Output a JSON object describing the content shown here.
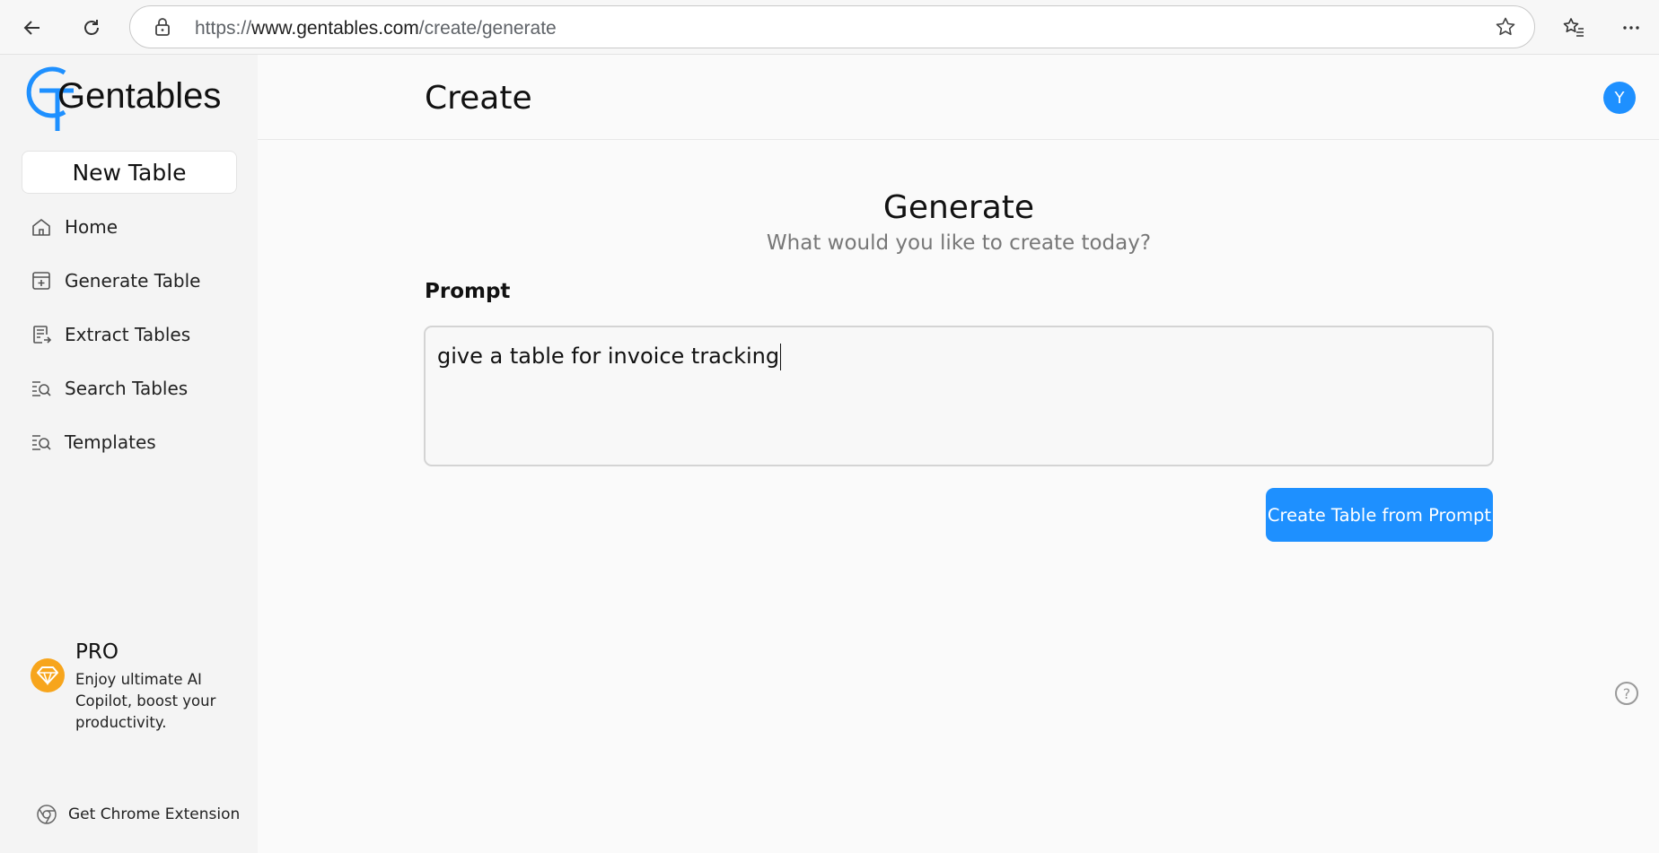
{
  "browser": {
    "url_scheme": "https://",
    "url_host": "www.gentables.com",
    "url_path": "/create/generate"
  },
  "sidebar": {
    "logo_text": "Gentables",
    "new_table_label": "New Table",
    "items": [
      {
        "label": "Home",
        "icon": "home-icon"
      },
      {
        "label": "Generate Table",
        "icon": "add-table-icon"
      },
      {
        "label": "Extract Tables",
        "icon": "extract-icon"
      },
      {
        "label": "Search Tables",
        "icon": "search-list-icon"
      },
      {
        "label": "Templates",
        "icon": "templates-icon"
      }
    ],
    "pro": {
      "title": "PRO",
      "description": "Enjoy ultimate AI Copilot, boost your productivity."
    },
    "extension_label": "Get Chrome Extension"
  },
  "header": {
    "title": "Create",
    "avatar_initial": "Y"
  },
  "main": {
    "heading": "Generate",
    "subheading": "What would you like to create today?",
    "prompt_label": "Prompt",
    "prompt_value": "give a table for invoice tracking",
    "create_button_label": "Create Table from Prompt",
    "help_symbol": "?"
  },
  "colors": {
    "accent": "#1e90ff",
    "pro_badge": "#f7a51c"
  }
}
